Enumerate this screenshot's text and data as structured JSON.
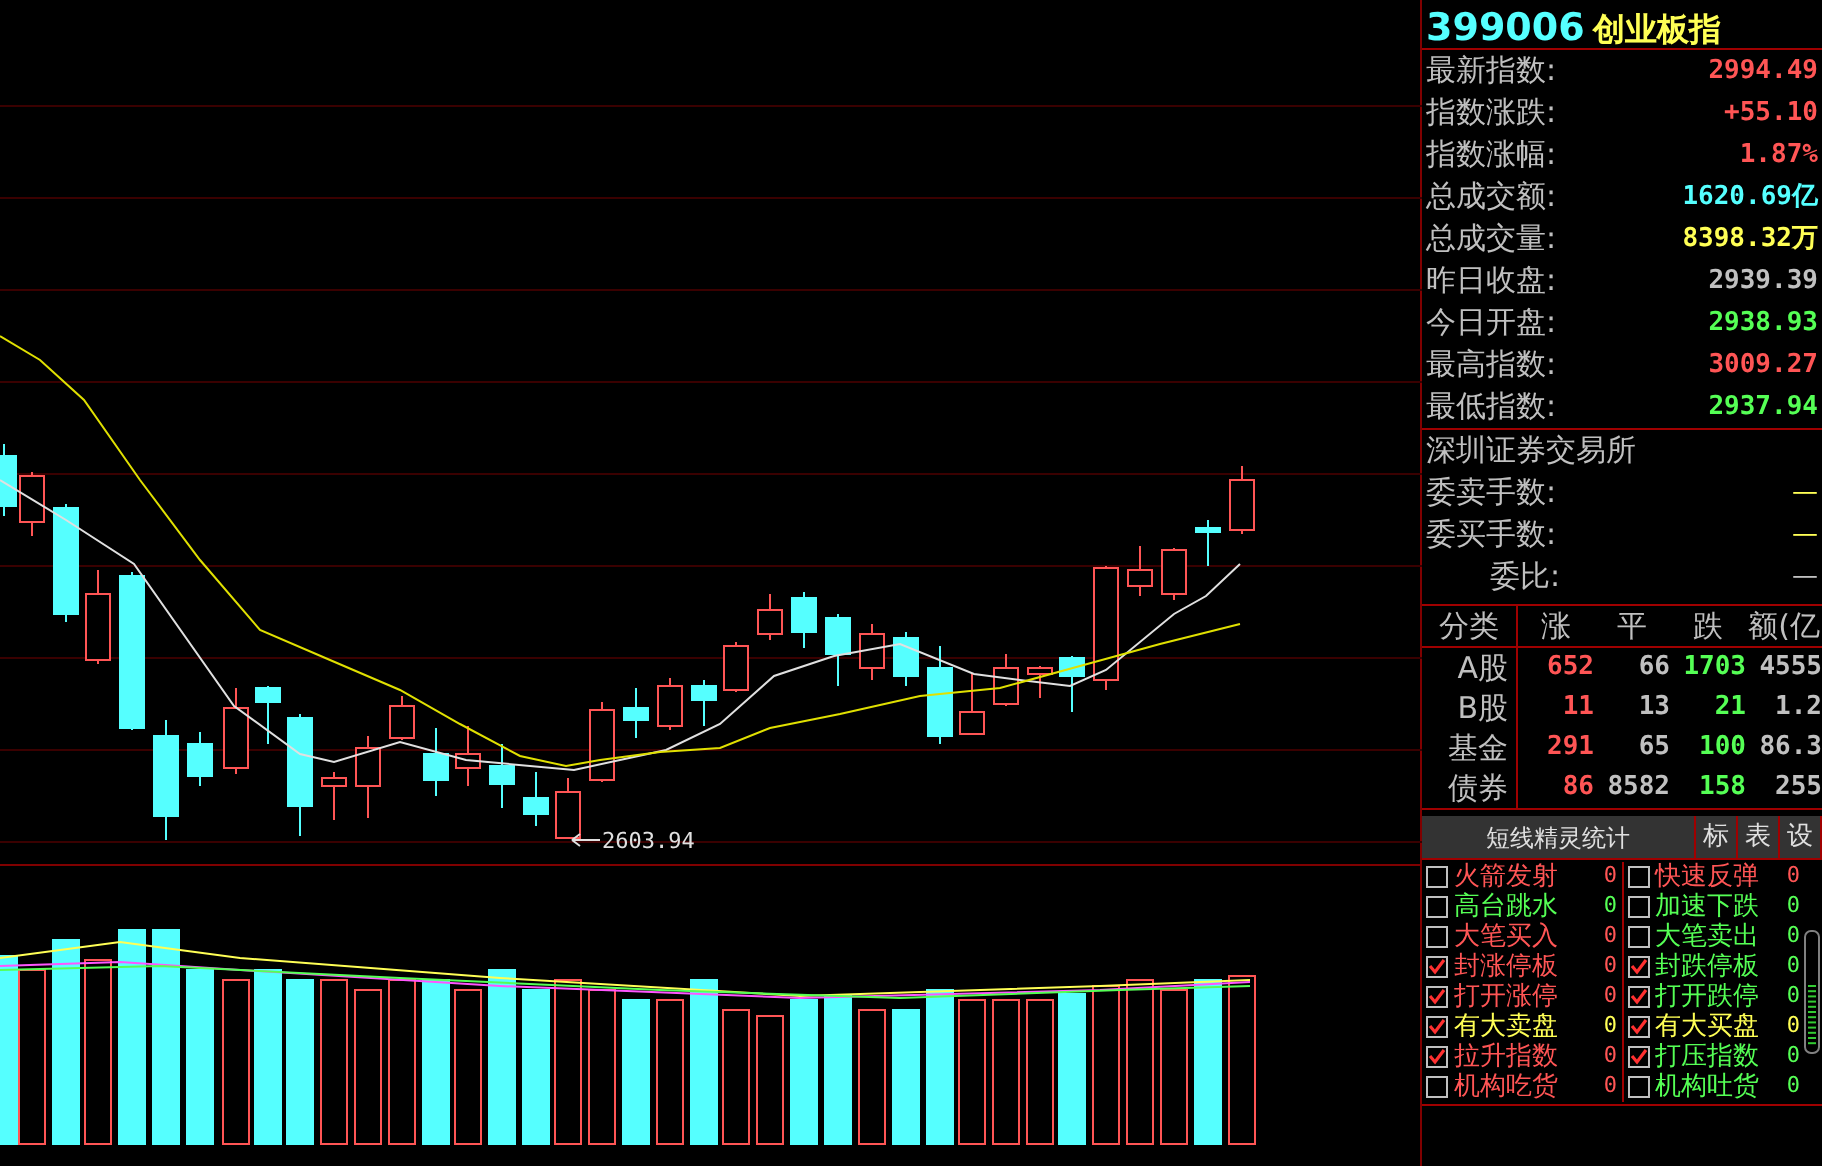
{
  "chart": {
    "low_marker": "2603.94"
  },
  "quote": {
    "code": "399006",
    "name": "创业板指",
    "rows": [
      {
        "label": "最新指数:",
        "value": "2994.49",
        "color": "#ff5555"
      },
      {
        "label": "指数涨跌:",
        "value": "+55.10",
        "color": "#ff5555"
      },
      {
        "label": "指数涨幅:",
        "value": "1.87%",
        "color": "#ff5555"
      },
      {
        "label": "总成交额:",
        "value": "1620.69亿",
        "color": "#55ffff"
      },
      {
        "label": "总成交量:",
        "value": "8398.32万",
        "color": "#ffff55"
      },
      {
        "label": "昨日收盘:",
        "value": "2939.39",
        "color": "#c0c0c0"
      },
      {
        "label": "今日开盘:",
        "value": "2938.93",
        "color": "#55ff55"
      },
      {
        "label": "最高指数:",
        "value": "3009.27",
        "color": "#ff5555"
      },
      {
        "label": "最低指数:",
        "value": "2937.94",
        "color": "#55ff55"
      }
    ],
    "exchange": "深圳证券交易所",
    "orders": [
      {
        "label": "委卖手数:",
        "value": "—",
        "color": "#ffff55"
      },
      {
        "label": "委买手数:",
        "value": "—",
        "color": "#ffff55"
      },
      {
        "label": "委比:",
        "value": "—",
        "color": "#c0c0c0"
      }
    ]
  },
  "breadth": {
    "columns": [
      "分类",
      "涨",
      "平",
      "跌",
      "额(亿"
    ],
    "rows": [
      [
        "A股",
        "652",
        "66",
        "1703",
        "4555"
      ],
      [
        "B股",
        "11",
        "13",
        "21",
        "1.2"
      ],
      [
        "基金",
        "291",
        "65",
        "100",
        "86.3"
      ],
      [
        "债券",
        "86",
        "8582",
        "158",
        "255"
      ]
    ]
  },
  "signals": {
    "title": "短线精灵统计",
    "buttons": [
      "标",
      "表",
      "设"
    ],
    "left": [
      {
        "label": "火箭发射",
        "count": "0",
        "checked": false,
        "color": "#ff5555"
      },
      {
        "label": "高台跳水",
        "count": "0",
        "checked": false,
        "color": "#55ff55"
      },
      {
        "label": "大笔买入",
        "count": "0",
        "checked": false,
        "color": "#ff5555"
      },
      {
        "label": "封涨停板",
        "count": "0",
        "checked": true,
        "color": "#ff5555"
      },
      {
        "label": "打开涨停",
        "count": "0",
        "checked": true,
        "color": "#ff5555"
      },
      {
        "label": "有大卖盘",
        "count": "0",
        "checked": true,
        "color": "#ffff55"
      },
      {
        "label": "拉升指数",
        "count": "0",
        "checked": true,
        "color": "#ff5555"
      },
      {
        "label": "机构吃货",
        "count": "0",
        "checked": false,
        "color": "#ff5555"
      }
    ],
    "right": [
      {
        "label": "快速反弹",
        "count": "0",
        "checked": false,
        "color": "#ff5555"
      },
      {
        "label": "加速下跌",
        "count": "0",
        "checked": false,
        "color": "#55ff55"
      },
      {
        "label": "大笔卖出",
        "count": "0",
        "checked": false,
        "color": "#55ff55"
      },
      {
        "label": "封跌停板",
        "count": "0",
        "checked": true,
        "color": "#55ff55"
      },
      {
        "label": "打开跌停",
        "count": "0",
        "checked": true,
        "color": "#55ff55"
      },
      {
        "label": "有大买盘",
        "count": "0",
        "checked": true,
        "color": "#ffff55"
      },
      {
        "label": "打压指数",
        "count": "0",
        "checked": true,
        "color": "#55ff55"
      },
      {
        "label": "机构吐货",
        "count": "0",
        "checked": false,
        "color": "#55ff55"
      }
    ]
  }
}
